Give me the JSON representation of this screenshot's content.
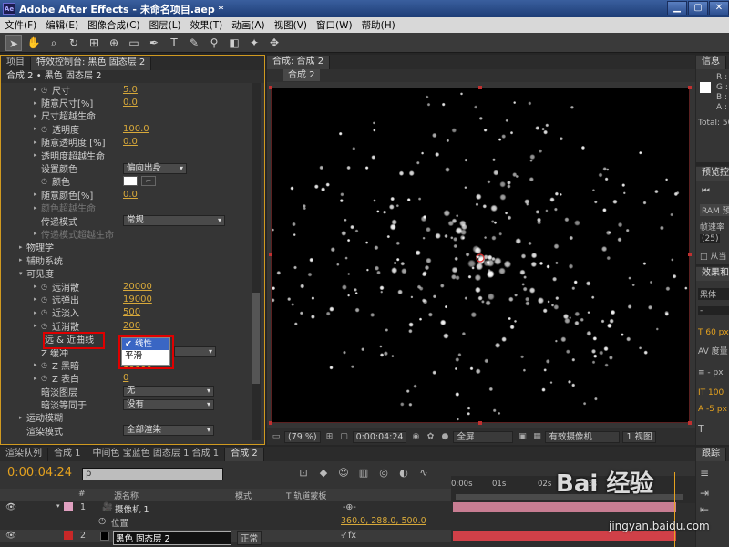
{
  "app": {
    "icon_text": "Ae",
    "title": "Adobe After Effects - 未命名项目.aep *",
    "window_buttons": [
      "▁",
      "▢",
      "✕"
    ]
  },
  "menu": [
    "文件(F)",
    "编辑(E)",
    "图像合成(C)",
    "图层(L)",
    "效果(T)",
    "动画(A)",
    "视图(V)",
    "窗口(W)",
    "帮助(H)"
  ],
  "toolbar": {
    "tools": [
      "selection-icon",
      "hand-icon",
      "zoom-icon",
      "rotate-icon",
      "camera-icon",
      "pan-behind-icon",
      "rectangle-icon",
      "pen-icon",
      "text-icon",
      "brush-icon",
      "clone-stamp-icon",
      "eraser-icon",
      "puppet-icon"
    ]
  },
  "effects_panel": {
    "tabs": [
      "项目",
      "特效控制台: 黑色 固态层 2"
    ],
    "breadcrumb": "合成 2 • 黑色 固态层 2",
    "rows": [
      {
        "indent": 36,
        "tri": "▸",
        "sw": true,
        "label": "尺寸",
        "value": "5.0"
      },
      {
        "indent": 36,
        "tri": "▸",
        "sw": false,
        "label": "随意尺寸[%]",
        "value": "0.0"
      },
      {
        "indent": 36,
        "tri": "▸",
        "sw": false,
        "label": "尺寸超越生命",
        "value": ""
      },
      {
        "indent": 36,
        "tri": "▸",
        "sw": true,
        "label": "透明度",
        "value": "100.0"
      },
      {
        "indent": 36,
        "tri": "▸",
        "sw": false,
        "label": "随意透明度 [%]",
        "value": "0.0"
      },
      {
        "indent": 36,
        "tri": "▸",
        "sw": false,
        "label": "透明度超越生命",
        "value": ""
      },
      {
        "indent": 44,
        "tri": "",
        "sw": false,
        "label": "设置颜色",
        "dropdown": "偏向出身",
        "dd_width": 70
      },
      {
        "indent": 44,
        "tri": "",
        "sw": true,
        "label": "颜色",
        "color": true
      },
      {
        "indent": 36,
        "tri": "▸",
        "sw": false,
        "label": "随意颜色[%]",
        "value": "0.0"
      },
      {
        "indent": 36,
        "tri": "▸",
        "sw": false,
        "label": "颜色超越生命",
        "value": "",
        "dim": true
      },
      {
        "indent": 44,
        "tri": "",
        "sw": false,
        "label": "传递模式",
        "dropdown": "常规",
        "dd_width": 112
      },
      {
        "indent": 36,
        "tri": "▸",
        "sw": false,
        "label": "传递模式超越生命",
        "value": "",
        "dim": true
      },
      {
        "indent": 20,
        "tri": "▸",
        "sw": false,
        "label": "物理学",
        "value": ""
      },
      {
        "indent": 20,
        "tri": "▸",
        "sw": false,
        "label": "辅助系统",
        "value": ""
      },
      {
        "indent": 20,
        "tri": "▾",
        "sw": false,
        "label": "可见度",
        "value": ""
      },
      {
        "indent": 36,
        "tri": "▸",
        "sw": true,
        "label": "远消散",
        "value": "20000"
      },
      {
        "indent": 36,
        "tri": "▸",
        "sw": true,
        "label": "远弹出",
        "value": "19000"
      },
      {
        "indent": 36,
        "tri": "▸",
        "sw": true,
        "label": "近淡入",
        "value": "500"
      },
      {
        "indent": 36,
        "tri": "▸",
        "sw": true,
        "label": "近消散",
        "value": "200"
      },
      {
        "indent": 48,
        "tri": "",
        "sw": false,
        "label": "远 & 近曲线",
        "value": ""
      },
      {
        "indent": 44,
        "tri": "",
        "sw": false,
        "label": "Z 缓冲",
        "value": ""
      },
      {
        "indent": 36,
        "tri": "▸",
        "sw": true,
        "label": "Z 黑暗",
        "value": "10000"
      },
      {
        "indent": 36,
        "tri": "▸",
        "sw": true,
        "label": "Z 表白",
        "value": "0"
      },
      {
        "indent": 44,
        "tri": "",
        "sw": false,
        "label": "暗淡图层",
        "dropdown": "无",
        "dd_width": 100
      },
      {
        "indent": 44,
        "tri": "",
        "sw": false,
        "label": "暗淡等同于",
        "dropdown": "没有",
        "dd_width": 100
      },
      {
        "indent": 20,
        "tri": "▸",
        "sw": false,
        "label": "运动模糊",
        "value": ""
      },
      {
        "indent": 28,
        "tri": "",
        "sw": false,
        "label": "渲染模式",
        "dropdown": "全部渲染",
        "dd_width": 100
      }
    ],
    "popup": {
      "items": [
        "✔ 线性",
        "平滑"
      ]
    }
  },
  "comp_panel": {
    "tab": "合成: 合成 2",
    "sub_tab": "合成 2",
    "zoom": "(79 %)",
    "timecode": "0:00:04:24",
    "resolution": "全屏",
    "camera": "有效摄像机",
    "views": "1 视图"
  },
  "info_panel": {
    "tab": "信息",
    "rows": [
      "R :",
      "G :",
      "B :",
      "A : 0",
      "Total: 50"
    ]
  },
  "preview_panel": {
    "tab": "预览控",
    "rows": [
      "RAM 预",
      "帧速率",
      "(25)",
      "从当"
    ]
  },
  "fx_panel": {
    "tab": "效果和",
    "rows": [
      "黑体",
      "-",
      "60 px",
      "度量",
      "- px",
      "100",
      "-5 px",
      "T"
    ]
  },
  "timeline": {
    "tabs": [
      "渲染队列",
      "合成 1",
      "中间色 宝蓝色 固态层 1 合成 1",
      "合成 2"
    ],
    "timecode": "0:00:04:24",
    "search_placeholder": "ρ",
    "col_num": "#",
    "col_source": "源名称",
    "col_mode": "模式",
    "col_track": "T 轨道蒙板",
    "ruler": [
      "0:00s",
      "01s",
      "02s",
      "03s",
      "04s"
    ],
    "layers": [
      {
        "num": "1",
        "name": "摄像机 1",
        "color": "#e0a0c0",
        "bar": "#c87d92"
      },
      {
        "num": "",
        "name": "位置",
        "value": "360.0, 288.0, 500.0"
      },
      {
        "num": "2",
        "name": "黑色 固态层 2",
        "color": "#c82828",
        "mode": "正常",
        "bar": "#d04048"
      }
    ]
  },
  "tracker_panel": {
    "tab": "跟踪"
  },
  "watermark": {
    "main": "Bai 经验",
    "sub": "jingyan.baidu.com"
  }
}
